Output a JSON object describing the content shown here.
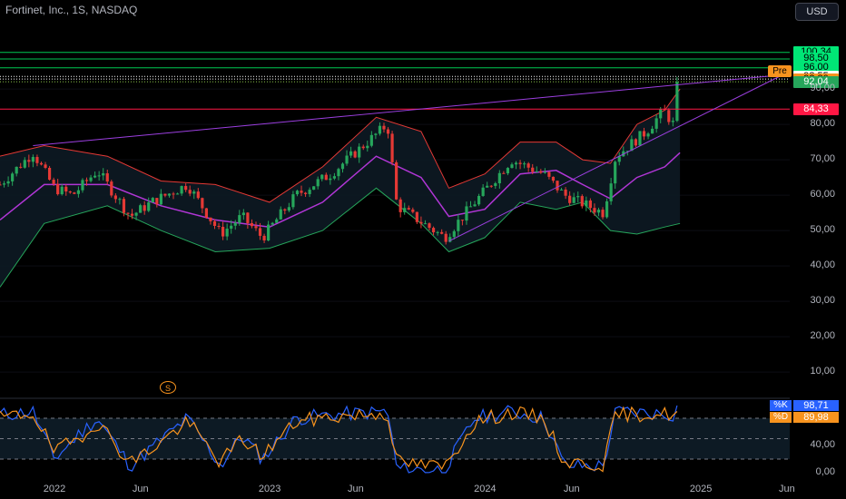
{
  "header": {
    "title": "Fortinet, Inc., 1S, NASDAQ"
  },
  "currency_button": "USD",
  "price_tags": [
    {
      "label": "100,34",
      "bg": "#00e676",
      "fg": "#000000"
    },
    {
      "label": "98,50",
      "bg": "#00e676",
      "fg": "#000000"
    },
    {
      "label": "96,00",
      "bg": "#00e676",
      "fg": "#000000"
    },
    {
      "label": "93,55",
      "bg": "#ffffff",
      "fg": "#000000"
    },
    {
      "label": "92,80",
      "bg": "#f7931e",
      "fg": "#000000"
    },
    {
      "label": "92,04",
      "bg": "#26a65b",
      "fg": "#ffffff"
    },
    {
      "label": "84,33",
      "bg": "#ff1744",
      "fg": "#ffffff"
    }
  ],
  "pre_label": "Pre",
  "y_labels": [
    "90,00",
    "80,00",
    "70,00",
    "60,00",
    "50,00",
    "40,00",
    "30,00",
    "20,00",
    "10,00"
  ],
  "osc_y_labels": [
    "40,00",
    "0,00"
  ],
  "x_labels": [
    "2022",
    "Jun",
    "2023",
    "Jun",
    "2024",
    "Jun",
    "2025",
    "Jun"
  ],
  "dividend_marker": "S",
  "stoch": {
    "k_key": "%K",
    "k_value": "98,71",
    "k_color": "#2962ff",
    "d_key": "%D",
    "d_value": "89,98",
    "d_color": "#f7931e"
  },
  "colors": {
    "up": "#26a65b",
    "down": "#e53935",
    "band_upper": "#e53935",
    "band_lower": "#26a65b",
    "basis": "#b136d6",
    "trend": "#9c3fe0",
    "hline_green": "#00c853",
    "hline_red": "#ff1744"
  },
  "chart_data": [
    {
      "type": "candlestick",
      "title": "Fortinet, Inc., 1S, NASDAQ",
      "ylim": [
        0,
        103
      ],
      "y_ticks": [
        10,
        20,
        30,
        40,
        50,
        60,
        70,
        80,
        90
      ],
      "horizontal_levels": [
        100.34,
        98.5,
        96.0,
        93.55,
        92.8,
        92.04,
        84.33
      ],
      "anchors": [
        {
          "date": "2021-10-01",
          "close": 63
        },
        {
          "date": "2021-11-26",
          "close": 72
        },
        {
          "date": "2022-01-01",
          "close": 62
        },
        {
          "date": "2022-02-01",
          "close": 60
        },
        {
          "date": "2022-03-15",
          "close": 67
        },
        {
          "date": "2022-05-10",
          "close": 54
        },
        {
          "date": "2022-06-15",
          "close": 58
        },
        {
          "date": "2022-08-15",
          "close": 63
        },
        {
          "date": "2022-10-10",
          "close": 49
        },
        {
          "date": "2022-11-15",
          "close": 54
        },
        {
          "date": "2022-12-20",
          "close": 48
        },
        {
          "date": "2023-02-15",
          "close": 60
        },
        {
          "date": "2023-04-15",
          "close": 66
        },
        {
          "date": "2023-07-20",
          "close": 80
        },
        {
          "date": "2023-08-05",
          "close": 57
        },
        {
          "date": "2023-10-25",
          "close": 48
        },
        {
          "date": "2023-12-15",
          "close": 58
        },
        {
          "date": "2024-02-15",
          "close": 70
        },
        {
          "date": "2024-04-10",
          "close": 66
        },
        {
          "date": "2024-05-15",
          "close": 60
        },
        {
          "date": "2024-07-20",
          "close": 55
        },
        {
          "date": "2024-08-10",
          "close": 71
        },
        {
          "date": "2024-10-01",
          "close": 78
        },
        {
          "date": "2024-10-30",
          "close": 84
        },
        {
          "date": "2024-11-20",
          "close": 79
        },
        {
          "date": "2024-11-27",
          "close": 92
        }
      ],
      "bollinger": {
        "upper": [
          [
            "2021-10-01",
            71
          ],
          [
            "2021-12-15",
            74
          ],
          [
            "2022-04-01",
            71
          ],
          [
            "2022-07-01",
            64
          ],
          [
            "2022-10-01",
            63
          ],
          [
            "2023-01-01",
            58
          ],
          [
            "2023-04-01",
            68
          ],
          [
            "2023-07-01",
            82
          ],
          [
            "2023-09-15",
            78
          ],
          [
            "2023-11-01",
            62
          ],
          [
            "2024-01-01",
            66
          ],
          [
            "2024-03-01",
            75
          ],
          [
            "2024-05-01",
            75
          ],
          [
            "2024-06-15",
            70
          ],
          [
            "2024-08-01",
            69
          ],
          [
            "2024-09-15",
            80
          ],
          [
            "2024-11-01",
            84
          ],
          [
            "2024-11-27",
            90
          ]
        ],
        "lower": [
          [
            "2021-10-01",
            34
          ],
          [
            "2021-12-15",
            52
          ],
          [
            "2022-04-01",
            57
          ],
          [
            "2022-07-01",
            50
          ],
          [
            "2022-10-01",
            44
          ],
          [
            "2023-01-01",
            45
          ],
          [
            "2023-04-01",
            50
          ],
          [
            "2023-07-01",
            62
          ],
          [
            "2023-09-15",
            52
          ],
          [
            "2023-11-01",
            44
          ],
          [
            "2024-01-01",
            48
          ],
          [
            "2024-03-01",
            58
          ],
          [
            "2024-05-01",
            56
          ],
          [
            "2024-06-15",
            58
          ],
          [
            "2024-08-01",
            50
          ],
          [
            "2024-09-15",
            49
          ],
          [
            "2024-11-01",
            51
          ],
          [
            "2024-11-27",
            52
          ]
        ],
        "basis": [
          [
            "2021-10-01",
            53
          ],
          [
            "2021-12-15",
            63
          ],
          [
            "2022-04-01",
            63
          ],
          [
            "2022-07-01",
            57
          ],
          [
            "2022-10-01",
            53
          ],
          [
            "2023-01-01",
            51
          ],
          [
            "2023-04-01",
            58
          ],
          [
            "2023-07-01",
            71
          ],
          [
            "2023-09-15",
            65
          ],
          [
            "2023-11-01",
            54
          ],
          [
            "2024-01-01",
            56
          ],
          [
            "2024-03-01",
            66
          ],
          [
            "2024-05-01",
            67
          ],
          [
            "2024-06-15",
            63
          ],
          [
            "2024-08-01",
            59
          ],
          [
            "2024-09-15",
            65
          ],
          [
            "2024-11-01",
            68
          ],
          [
            "2024-11-27",
            72
          ]
        ]
      },
      "trend_lines": [
        {
          "from": [
            "2021-11-26",
            74
          ],
          "to": [
            "2025-05-20",
            94
          ]
        },
        {
          "from": [
            "2023-11-01",
            47
          ],
          "to": [
            "2025-05-20",
            94
          ]
        }
      ]
    },
    {
      "type": "line",
      "title": "Stochastic",
      "ylim": [
        0,
        100
      ],
      "bands": [
        20,
        50,
        80
      ],
      "series": [
        {
          "name": "%K",
          "anchors": [
            [
              "2021-10-01",
              85
            ],
            [
              "2021-11-26",
              90
            ],
            [
              "2022-01-01",
              20
            ],
            [
              "2022-02-10",
              55
            ],
            [
              "2022-03-15",
              80
            ],
            [
              "2022-05-10",
              10
            ],
            [
              "2022-06-20",
              40
            ],
            [
              "2022-08-15",
              80
            ],
            [
              "2022-10-10",
              10
            ],
            [
              "2022-11-15",
              55
            ],
            [
              "2022-12-20",
              20
            ],
            [
              "2023-02-15",
              80
            ],
            [
              "2023-04-15",
              85
            ],
            [
              "2023-07-20",
              90
            ],
            [
              "2023-08-05",
              5
            ],
            [
              "2023-10-25",
              5
            ],
            [
              "2023-12-15",
              80
            ],
            [
              "2024-02-15",
              90
            ],
            [
              "2024-04-10",
              80
            ],
            [
              "2024-05-15",
              10
            ],
            [
              "2024-07-20",
              10
            ],
            [
              "2024-08-10",
              90
            ],
            [
              "2024-10-01",
              88
            ],
            [
              "2024-11-20",
              85
            ],
            [
              "2024-11-27",
              98.71
            ]
          ]
        },
        {
          "name": "%D",
          "anchors": [
            [
              "2021-10-01",
              80
            ],
            [
              "2021-11-26",
              88
            ],
            [
              "2022-01-01",
              30
            ],
            [
              "2022-02-10",
              50
            ],
            [
              "2022-03-15",
              75
            ],
            [
              "2022-05-10",
              15
            ],
            [
              "2022-06-20",
              38
            ],
            [
              "2022-08-15",
              75
            ],
            [
              "2022-10-10",
              15
            ],
            [
              "2022-11-15",
              50
            ],
            [
              "2022-12-20",
              25
            ],
            [
              "2023-02-15",
              75
            ],
            [
              "2023-04-15",
              82
            ],
            [
              "2023-07-20",
              88
            ],
            [
              "2023-08-05",
              15
            ],
            [
              "2023-10-25",
              8
            ],
            [
              "2023-12-15",
              75
            ],
            [
              "2024-02-15",
              88
            ],
            [
              "2024-04-10",
              80
            ],
            [
              "2024-05-15",
              15
            ],
            [
              "2024-07-20",
              12
            ],
            [
              "2024-08-10",
              85
            ],
            [
              "2024-10-01",
              86
            ],
            [
              "2024-11-20",
              86
            ],
            [
              "2024-11-27",
              89.98
            ]
          ]
        }
      ]
    }
  ]
}
